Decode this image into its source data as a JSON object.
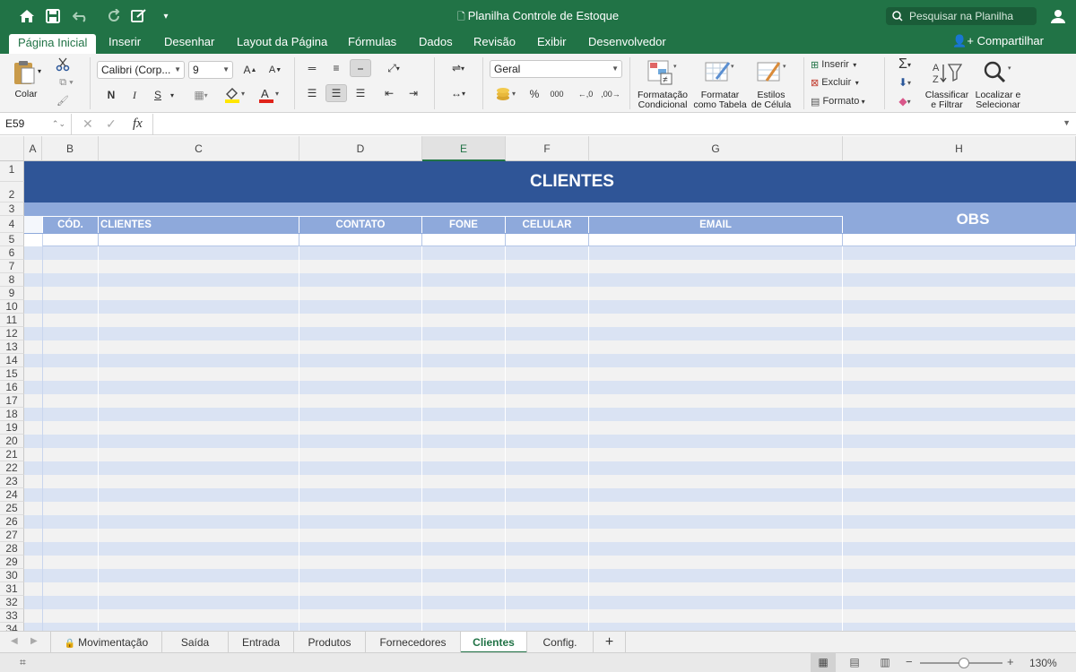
{
  "window": {
    "title": "Planilha Controle de Estoque",
    "search_placeholder": "Pesquisar na Planilha"
  },
  "ribbon_tabs": [
    "Página Inicial",
    "Inserir",
    "Desenhar",
    "Layout da Página",
    "Fórmulas",
    "Dados",
    "Revisão",
    "Exibir",
    "Desenvolvedor"
  ],
  "share_label": "Compartilhar",
  "ribbon": {
    "paste_label": "Colar",
    "font_name": "Calibri (Corp...",
    "font_size": "9",
    "bold": "N",
    "italic": "I",
    "underline": "S",
    "number_format": "Geral",
    "percent": "%",
    "thousands": "000",
    "cond_format_line1": "Formatação",
    "cond_format_line2": "Condicional",
    "format_table_line1": "Formatar",
    "format_table_line2": "como Tabela",
    "cell_styles_line1": "Estilos",
    "cell_styles_line2": "de Célula",
    "insert": "Inserir",
    "delete": "Excluir",
    "format": "Formato",
    "sort_line1": "Classificar",
    "sort_line2": "e Filtrar",
    "find_line1": "Localizar e",
    "find_line2": "Selecionar"
  },
  "formula_bar": {
    "name_box": "E59",
    "fx": "fx",
    "content": ""
  },
  "columns": [
    "A",
    "B",
    "C",
    "D",
    "E",
    "F",
    "G",
    "H"
  ],
  "selected_column": "E",
  "rows": [
    "1",
    "2",
    "3",
    "4",
    "5",
    "6",
    "7",
    "8",
    "9",
    "10",
    "11",
    "12",
    "13",
    "14",
    "15",
    "16",
    "17",
    "18",
    "19",
    "20",
    "21",
    "22",
    "23",
    "24",
    "25",
    "26",
    "27",
    "28",
    "29",
    "30",
    "31",
    "32",
    "33",
    "34"
  ],
  "sheet": {
    "banner_title": "CLIENTES",
    "table_headers": [
      "CÓD.",
      "CLIENTES",
      "CONTATO",
      "FONE",
      "CELULAR",
      "EMAIL"
    ],
    "obs_header": "OBS"
  },
  "sheet_tabs": [
    "Movimentação",
    "Saída",
    "Entrada",
    "Produtos",
    "Fornecedores",
    "Clientes",
    "Config."
  ],
  "active_sheet": "Clientes",
  "add_sheet": "+",
  "status": {
    "zoom": "130%",
    "zoom_minus": "−",
    "zoom_plus": "+"
  },
  "colors": {
    "accent": "#217346",
    "banner": "#2f5597",
    "header_band": "#8ea9db",
    "row_band": "#dae3f3",
    "row_alt": "#f2f2f2"
  }
}
